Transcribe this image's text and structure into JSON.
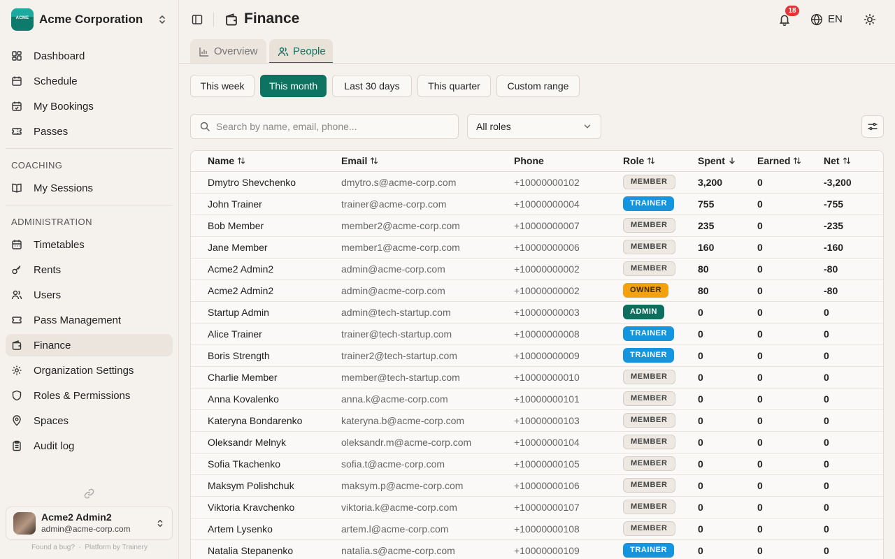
{
  "org": {
    "name": "Acme Corporation",
    "logo_text": "ACME"
  },
  "nav": {
    "main": [
      {
        "label": "Dashboard",
        "icon": "dashboard-icon"
      },
      {
        "label": "Schedule",
        "icon": "calendar-icon"
      },
      {
        "label": "My Bookings",
        "icon": "calendar-check-icon"
      },
      {
        "label": "Passes",
        "icon": "ticket-icon"
      }
    ],
    "coaching_title": "COACHING",
    "coaching": [
      {
        "label": "My Sessions",
        "icon": "book-open-icon"
      }
    ],
    "admin_title": "ADMINISTRATION",
    "admin": [
      {
        "label": "Timetables",
        "icon": "calendar-grid-icon"
      },
      {
        "label": "Rents",
        "icon": "key-icon"
      },
      {
        "label": "Users",
        "icon": "users-icon"
      },
      {
        "label": "Pass Management",
        "icon": "ticket-icon"
      },
      {
        "label": "Finance",
        "icon": "wallet-icon",
        "active": true
      },
      {
        "label": "Organization Settings",
        "icon": "gear-icon"
      },
      {
        "label": "Roles & Permissions",
        "icon": "shield-icon"
      },
      {
        "label": "Spaces",
        "icon": "map-pin-icon"
      },
      {
        "label": "Audit log",
        "icon": "clipboard-icon"
      }
    ]
  },
  "user": {
    "name": "Acme2 Admin2",
    "email": "admin@acme-corp.com"
  },
  "footer": {
    "bug_link": "Found a bug?",
    "separator": "·",
    "platform": "Platform by Trainery"
  },
  "header": {
    "title": "Finance",
    "notification_count": "18",
    "language": "EN"
  },
  "tabs": [
    {
      "label": "Overview",
      "icon": "bar-chart-icon"
    },
    {
      "label": "People",
      "icon": "users-icon",
      "active": true
    }
  ],
  "ranges": [
    "This week",
    "This month",
    "Last 30 days",
    "This quarter",
    "Custom range"
  ],
  "active_range": "This month",
  "filters": {
    "search_placeholder": "Search by name, email, phone...",
    "role_value": "All roles"
  },
  "table": {
    "columns": [
      "Name",
      "Email",
      "Phone",
      "Role",
      "Spent",
      "Earned",
      "Net"
    ],
    "rows": [
      {
        "name": "Dmytro Shevchenko",
        "email": "dmytro.s@acme-corp.com",
        "phone": "+10000000102",
        "role": "MEMBER",
        "spent": "3,200",
        "earned": "0",
        "net": "-3,200"
      },
      {
        "name": "John Trainer",
        "email": "trainer@acme-corp.com",
        "phone": "+10000000004",
        "role": "TRAINER",
        "spent": "755",
        "earned": "0",
        "net": "-755"
      },
      {
        "name": "Bob Member",
        "email": "member2@acme-corp.com",
        "phone": "+10000000007",
        "role": "MEMBER",
        "spent": "235",
        "earned": "0",
        "net": "-235"
      },
      {
        "name": "Jane Member",
        "email": "member1@acme-corp.com",
        "phone": "+10000000006",
        "role": "MEMBER",
        "spent": "160",
        "earned": "0",
        "net": "-160"
      },
      {
        "name": "Acme2 Admin2",
        "email": "admin@acme-corp.com",
        "phone": "+10000000002",
        "role": "MEMBER",
        "spent": "80",
        "earned": "0",
        "net": "-80"
      },
      {
        "name": "Acme2 Admin2",
        "email": "admin@acme-corp.com",
        "phone": "+10000000002",
        "role": "OWNER",
        "spent": "80",
        "earned": "0",
        "net": "-80"
      },
      {
        "name": "Startup Admin",
        "email": "admin@tech-startup.com",
        "phone": "+10000000003",
        "role": "ADMIN",
        "spent": "0",
        "earned": "0",
        "net": "0"
      },
      {
        "name": "Alice Trainer",
        "email": "trainer@tech-startup.com",
        "phone": "+10000000008",
        "role": "TRAINER",
        "spent": "0",
        "earned": "0",
        "net": "0"
      },
      {
        "name": "Boris Strength",
        "email": "trainer2@tech-startup.com",
        "phone": "+10000000009",
        "role": "TRAINER",
        "spent": "0",
        "earned": "0",
        "net": "0"
      },
      {
        "name": "Charlie Member",
        "email": "member@tech-startup.com",
        "phone": "+10000000010",
        "role": "MEMBER",
        "spent": "0",
        "earned": "0",
        "net": "0"
      },
      {
        "name": "Anna Kovalenko",
        "email": "anna.k@acme-corp.com",
        "phone": "+10000000101",
        "role": "MEMBER",
        "spent": "0",
        "earned": "0",
        "net": "0"
      },
      {
        "name": "Kateryna Bondarenko",
        "email": "kateryna.b@acme-corp.com",
        "phone": "+10000000103",
        "role": "MEMBER",
        "spent": "0",
        "earned": "0",
        "net": "0"
      },
      {
        "name": "Oleksandr Melnyk",
        "email": "oleksandr.m@acme-corp.com",
        "phone": "+10000000104",
        "role": "MEMBER",
        "spent": "0",
        "earned": "0",
        "net": "0"
      },
      {
        "name": "Sofia Tkachenko",
        "email": "sofia.t@acme-corp.com",
        "phone": "+10000000105",
        "role": "MEMBER",
        "spent": "0",
        "earned": "0",
        "net": "0"
      },
      {
        "name": "Maksym Polishchuk",
        "email": "maksym.p@acme-corp.com",
        "phone": "+10000000106",
        "role": "MEMBER",
        "spent": "0",
        "earned": "0",
        "net": "0"
      },
      {
        "name": "Viktoria Kravchenko",
        "email": "viktoria.k@acme-corp.com",
        "phone": "+10000000107",
        "role": "MEMBER",
        "spent": "0",
        "earned": "0",
        "net": "0"
      },
      {
        "name": "Artem Lysenko",
        "email": "artem.l@acme-corp.com",
        "phone": "+10000000108",
        "role": "MEMBER",
        "spent": "0",
        "earned": "0",
        "net": "0"
      },
      {
        "name": "Natalia Stepanenko",
        "email": "natalia.s@acme-corp.com",
        "phone": "+10000000109",
        "role": "TRAINER",
        "spent": "0",
        "earned": "0",
        "net": "0"
      }
    ]
  },
  "colors": {
    "accent": "#0e7361",
    "trainer": "#1595dd",
    "owner": "#f3a10e",
    "admin": "#0e6f5e",
    "badge_notification": "#e5333a"
  }
}
